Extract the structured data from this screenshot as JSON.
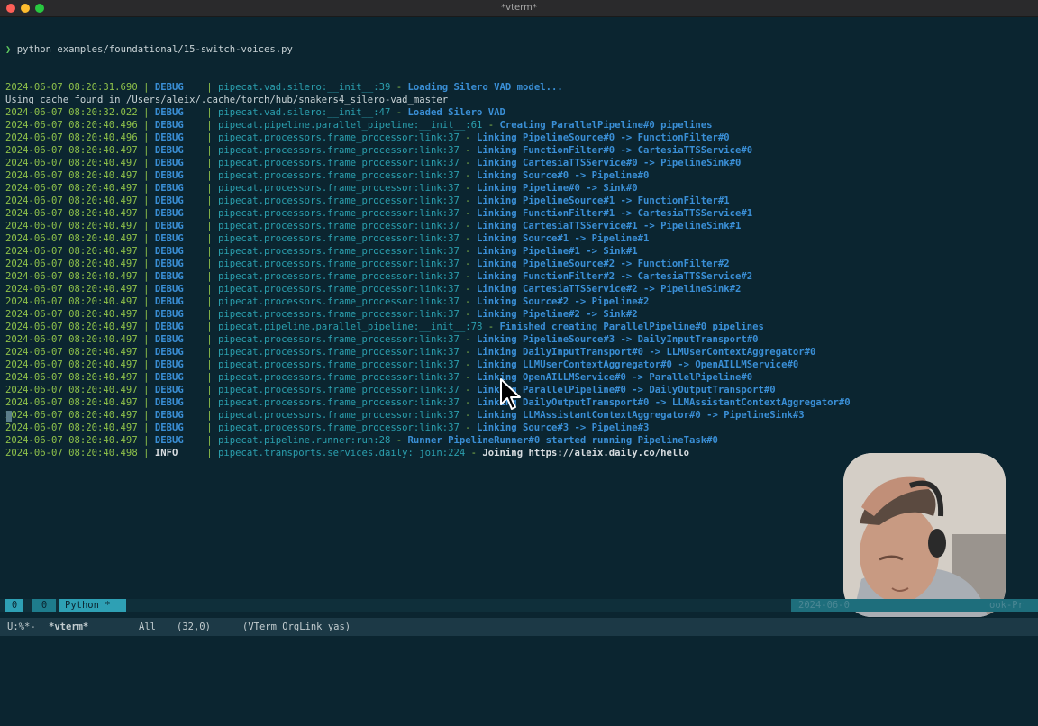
{
  "window": {
    "title": "*vterm*"
  },
  "terminal": {
    "command_prompt": "❯",
    "command": " python examples/foundational/15-switch-voices.py",
    "cache_line": "Using cache found in /Users/aleix/.cache/torch/hub/snakers4_silero-vad_master",
    "log_lines": [
      {
        "ts": "2024-06-07 08:20:31.690",
        "lvl": "DEBUG",
        "src": "pipecat.vad.silero:__init__:39",
        "msg": "Loading Silero VAD model..."
      },
      {
        "ts": "2024-06-07 08:20:32.022",
        "lvl": "DEBUG",
        "src": "pipecat.vad.silero:__init__:47",
        "msg": "Loaded Silero VAD"
      },
      {
        "ts": "2024-06-07 08:20:40.496",
        "lvl": "DEBUG",
        "src": "pipecat.pipeline.parallel_pipeline:__init__:61",
        "msg": "Creating ParallelPipeline#0 pipelines"
      },
      {
        "ts": "2024-06-07 08:20:40.496",
        "lvl": "DEBUG",
        "src": "pipecat.processors.frame_processor:link:37",
        "msg": "Linking PipelineSource#0 -> FunctionFilter#0"
      },
      {
        "ts": "2024-06-07 08:20:40.497",
        "lvl": "DEBUG",
        "src": "pipecat.processors.frame_processor:link:37",
        "msg": "Linking FunctionFilter#0 -> CartesiaTTSService#0"
      },
      {
        "ts": "2024-06-07 08:20:40.497",
        "lvl": "DEBUG",
        "src": "pipecat.processors.frame_processor:link:37",
        "msg": "Linking CartesiaTTSService#0 -> PipelineSink#0"
      },
      {
        "ts": "2024-06-07 08:20:40.497",
        "lvl": "DEBUG",
        "src": "pipecat.processors.frame_processor:link:37",
        "msg": "Linking Source#0 -> Pipeline#0"
      },
      {
        "ts": "2024-06-07 08:20:40.497",
        "lvl": "DEBUG",
        "src": "pipecat.processors.frame_processor:link:37",
        "msg": "Linking Pipeline#0 -> Sink#0"
      },
      {
        "ts": "2024-06-07 08:20:40.497",
        "lvl": "DEBUG",
        "src": "pipecat.processors.frame_processor:link:37",
        "msg": "Linking PipelineSource#1 -> FunctionFilter#1"
      },
      {
        "ts": "2024-06-07 08:20:40.497",
        "lvl": "DEBUG",
        "src": "pipecat.processors.frame_processor:link:37",
        "msg": "Linking FunctionFilter#1 -> CartesiaTTSService#1"
      },
      {
        "ts": "2024-06-07 08:20:40.497",
        "lvl": "DEBUG",
        "src": "pipecat.processors.frame_processor:link:37",
        "msg": "Linking CartesiaTTSService#1 -> PipelineSink#1"
      },
      {
        "ts": "2024-06-07 08:20:40.497",
        "lvl": "DEBUG",
        "src": "pipecat.processors.frame_processor:link:37",
        "msg": "Linking Source#1 -> Pipeline#1"
      },
      {
        "ts": "2024-06-07 08:20:40.497",
        "lvl": "DEBUG",
        "src": "pipecat.processors.frame_processor:link:37",
        "msg": "Linking Pipeline#1 -> Sink#1"
      },
      {
        "ts": "2024-06-07 08:20:40.497",
        "lvl": "DEBUG",
        "src": "pipecat.processors.frame_processor:link:37",
        "msg": "Linking PipelineSource#2 -> FunctionFilter#2"
      },
      {
        "ts": "2024-06-07 08:20:40.497",
        "lvl": "DEBUG",
        "src": "pipecat.processors.frame_processor:link:37",
        "msg": "Linking FunctionFilter#2 -> CartesiaTTSService#2"
      },
      {
        "ts": "2024-06-07 08:20:40.497",
        "lvl": "DEBUG",
        "src": "pipecat.processors.frame_processor:link:37",
        "msg": "Linking CartesiaTTSService#2 -> PipelineSink#2"
      },
      {
        "ts": "2024-06-07 08:20:40.497",
        "lvl": "DEBUG",
        "src": "pipecat.processors.frame_processor:link:37",
        "msg": "Linking Source#2 -> Pipeline#2"
      },
      {
        "ts": "2024-06-07 08:20:40.497",
        "lvl": "DEBUG",
        "src": "pipecat.processors.frame_processor:link:37",
        "msg": "Linking Pipeline#2 -> Sink#2"
      },
      {
        "ts": "2024-06-07 08:20:40.497",
        "lvl": "DEBUG",
        "src": "pipecat.pipeline.parallel_pipeline:__init__:78",
        "msg": "Finished creating ParallelPipeline#0 pipelines"
      },
      {
        "ts": "2024-06-07 08:20:40.497",
        "lvl": "DEBUG",
        "src": "pipecat.processors.frame_processor:link:37",
        "msg": "Linking PipelineSource#3 -> DailyInputTransport#0"
      },
      {
        "ts": "2024-06-07 08:20:40.497",
        "lvl": "DEBUG",
        "src": "pipecat.processors.frame_processor:link:37",
        "msg": "Linking DailyInputTransport#0 -> LLMUserContextAggregator#0"
      },
      {
        "ts": "2024-06-07 08:20:40.497",
        "lvl": "DEBUG",
        "src": "pipecat.processors.frame_processor:link:37",
        "msg": "Linking LLMUserContextAggregator#0 -> OpenAILLMService#0"
      },
      {
        "ts": "2024-06-07 08:20:40.497",
        "lvl": "DEBUG",
        "src": "pipecat.processors.frame_processor:link:37",
        "msg": "Linking OpenAILLMService#0 -> ParallelPipeline#0"
      },
      {
        "ts": "2024-06-07 08:20:40.497",
        "lvl": "DEBUG",
        "src": "pipecat.processors.frame_processor:link:37",
        "msg": "Linking ParallelPipeline#0 -> DailyOutputTransport#0"
      },
      {
        "ts": "2024-06-07 08:20:40.497",
        "lvl": "DEBUG",
        "src": "pipecat.processors.frame_processor:link:37",
        "msg": "Linking DailyOutputTransport#0 -> LLMAssistantContextAggregator#0"
      },
      {
        "ts": "2024-06-07 08:20:40.497",
        "lvl": "DEBUG",
        "src": "pipecat.processors.frame_processor:link:37",
        "msg": "Linking LLMAssistantContextAggregator#0 -> PipelineSink#3"
      },
      {
        "ts": "2024-06-07 08:20:40.497",
        "lvl": "DEBUG",
        "src": "pipecat.processors.frame_processor:link:37",
        "msg": "Linking Source#3 -> Pipeline#3"
      },
      {
        "ts": "2024-06-07 08:20:40.497",
        "lvl": "DEBUG",
        "src": "pipecat.pipeline.runner:run:28",
        "msg": "Runner PipelineRunner#0 started running PipelineTask#0"
      },
      {
        "ts": "2024-06-07 08:20:40.498",
        "lvl": "INFO",
        "src": "pipecat.transports.services.daily:_join:224",
        "msg": "Joining https://aleix.daily.co/hello"
      }
    ]
  },
  "statusbar": {
    "window_index": "0",
    "pane_index": "0",
    "pane_name": "Python *",
    "right_text": "2024-06-0",
    "right_tail": "ook-Pr"
  },
  "modeline": {
    "state": "U:%*-",
    "buffer": "*vterm*",
    "position": "All",
    "linecol": "(32,0)",
    "modes": "(VTerm OrgLink yas)"
  },
  "colors": {
    "background": "#0b2530",
    "timestamp": "#8ec14a",
    "debug": "#3a8fd6",
    "source": "#2b9fae"
  }
}
